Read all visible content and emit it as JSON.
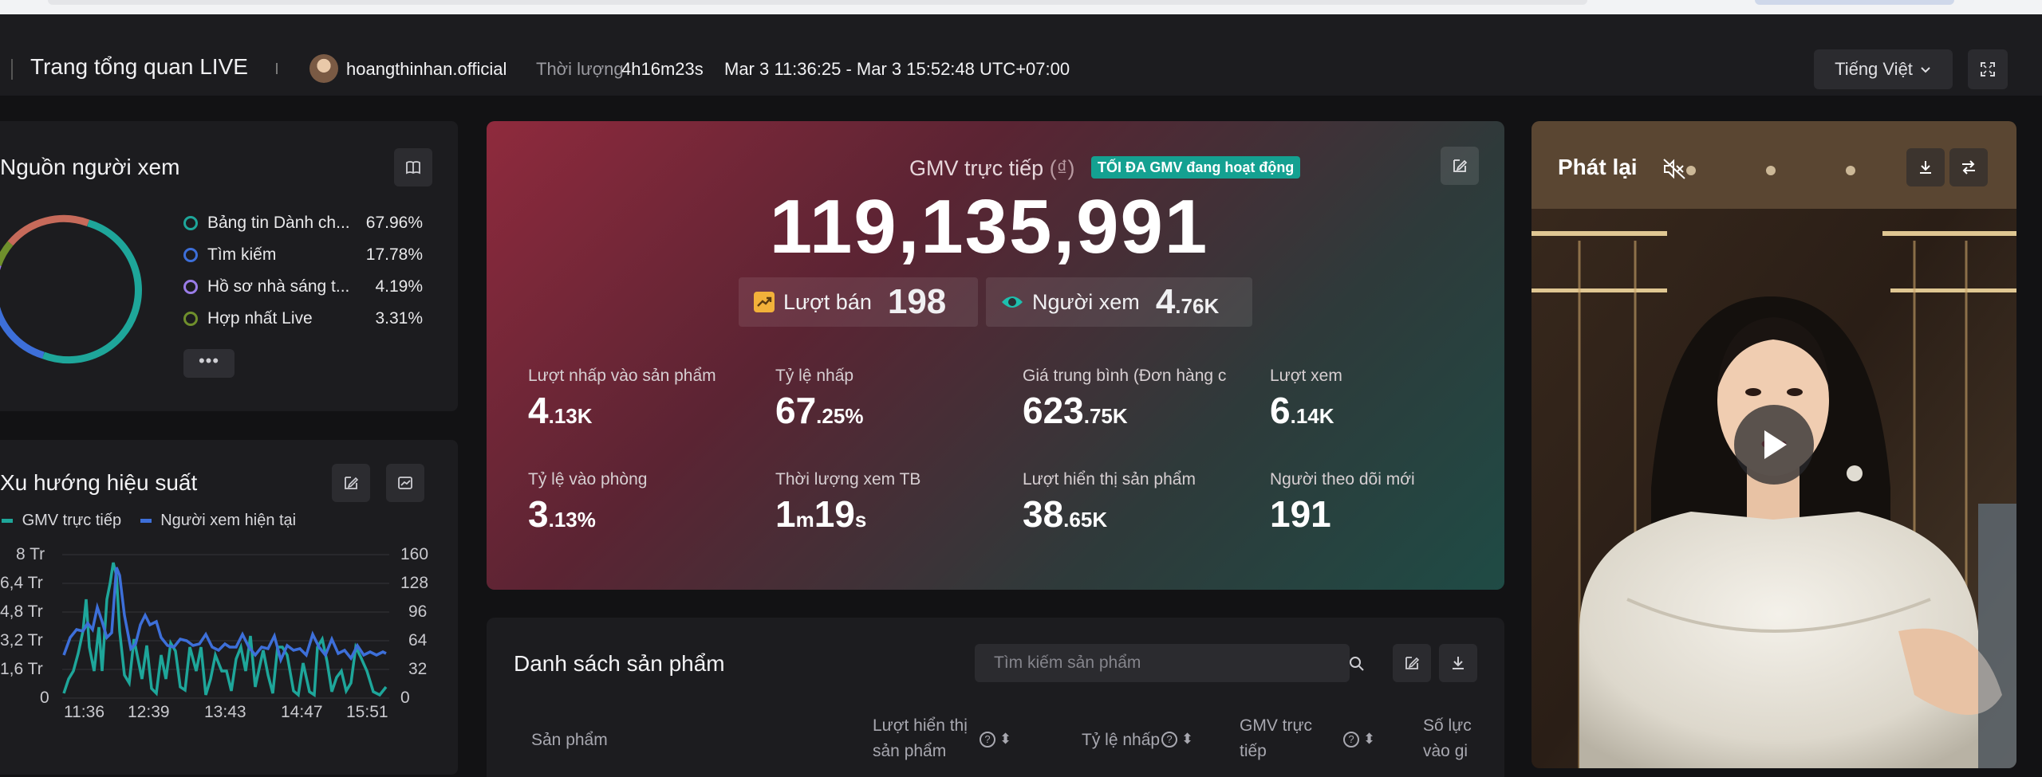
{
  "header": {
    "title": "Trang tổng quan LIVE",
    "account": "hoangthinhan.official",
    "duration_label": "Thời lượng",
    "duration_value": "4h16m23s",
    "time_range": "Mar 3 11:36:25 - Mar 3 15:52:48 UTC+07:00",
    "language": "Tiếng Việt"
  },
  "viewer_source": {
    "title": "Nguồn người xem",
    "items": [
      {
        "label": "Bảng tin Dành ch...",
        "pct": "67.96%",
        "color": "#1ea69a"
      },
      {
        "label": "Tìm kiếm",
        "pct": "17.78%",
        "color": "#3d6fd9"
      },
      {
        "label": "Hồ sơ nhà sáng t...",
        "pct": "4.19%",
        "color": "#9a7ce8"
      },
      {
        "label": "Hợp nhất Live",
        "pct": "3.31%",
        "color": "#6f8f2c"
      }
    ],
    "more": "•••"
  },
  "trend": {
    "title": "Xu hướng hiệu suất",
    "legend_gmv": "GMV trực tiếp",
    "legend_viewers": "Người xem hiện tại",
    "left_ticks": [
      "8 Tr",
      "6,4 Tr",
      "4,8 Tr",
      "3,2 Tr",
      "1,6 Tr",
      "0"
    ],
    "right_ticks": [
      "160",
      "128",
      "96",
      "64",
      "32",
      "0"
    ],
    "x_ticks": [
      "11:36",
      "12:39",
      "13:43",
      "14:47",
      "15:51"
    ]
  },
  "gmv": {
    "title_prefix": "GMV trực tiếp",
    "title_unit": "(₫)",
    "badge": "TỐI ĐA GMV đang hoạt động",
    "value": "119,135,991",
    "sales_label": "Lượt bán",
    "sales_value": "198",
    "viewers_label": "Người xem",
    "viewers_value_main": "4",
    "viewers_value_sub": ".76K",
    "metrics": [
      {
        "label": "Lượt nhấp vào sản phẩm",
        "main": "4",
        "sub": ".13K"
      },
      {
        "label": "Tỷ lệ nhấp",
        "main": "67",
        "sub": ".25%"
      },
      {
        "label": "Giá trung bình (Đơn hàng c",
        "main": "623",
        "sub": ".75K"
      },
      {
        "label": "Lượt xem",
        "main": "6",
        "sub": ".14K"
      },
      {
        "label": "Tỷ lệ vào phòng",
        "main": "3",
        "sub": ".13%"
      },
      {
        "label": "Thời lượng xem TB",
        "main": "1",
        "sub_m": "m",
        "main2": "19",
        "sub_s": "s"
      },
      {
        "label": "Lượt hiển thị sản phẩm",
        "main": "38",
        "sub": ".65K"
      },
      {
        "label": "Người theo dõi mới",
        "main": "191",
        "sub": ""
      }
    ]
  },
  "playback": {
    "title": "Phát lại"
  },
  "products": {
    "title": "Danh sách sản phẩm",
    "search_placeholder": "Tìm kiếm sản phẩm",
    "col_product": "Sản phẩm",
    "col_impressions_1": "Lượt hiển thị",
    "col_impressions_2": "sản phẩm",
    "col_ctr": "Tỷ lệ nhấp",
    "col_gmv_1": "GMV trực",
    "col_gmv_2": "tiếp",
    "col_clicks_1": "Số lực",
    "col_clicks_2": "vào gi"
  }
}
